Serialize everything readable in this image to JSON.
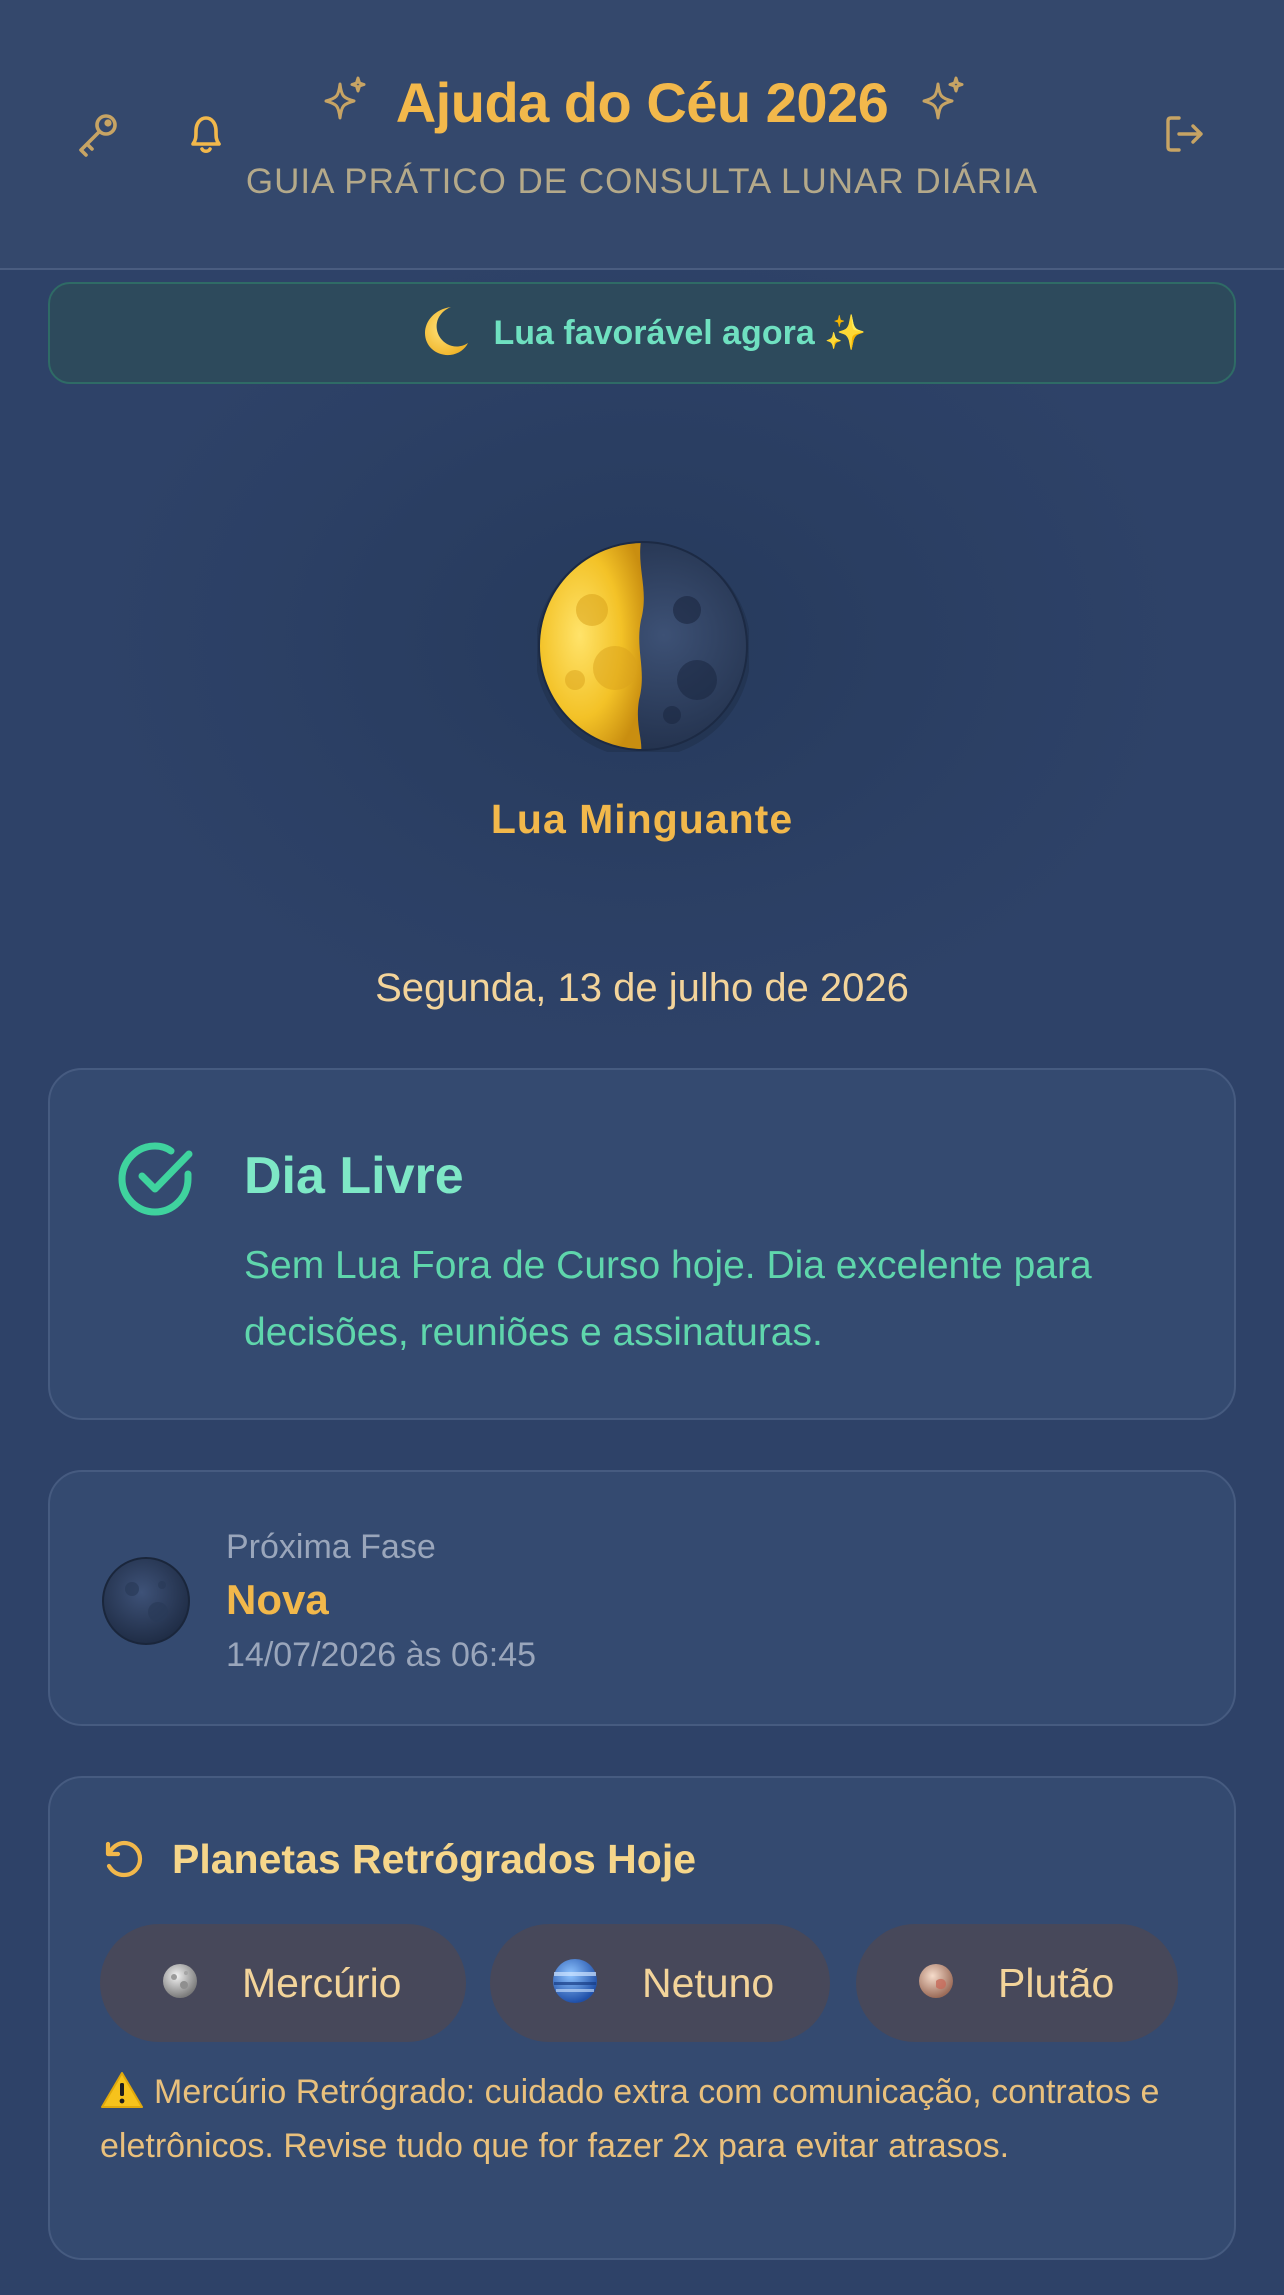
{
  "header": {
    "title": "Ajuda do Céu 2026",
    "subtitle": "GUIA PRÁTICO DE CONSULTA LUNAR DIÁRIA",
    "left_icons": [
      "key-icon",
      "bell-icon"
    ],
    "right_icons": [
      "logout-icon"
    ],
    "decor_icons": [
      "sparkle-icon",
      "sparkle-icon"
    ]
  },
  "banner": {
    "icon": "crescent-moon-icon",
    "text": "Lua favorável agora ✨"
  },
  "moon": {
    "phase_name": "Lua Minguante",
    "date": "Segunda, 13 de julho de 2026"
  },
  "dia_livre": {
    "title": "Dia Livre",
    "text": "Sem Lua Fora de Curso hoje. Dia excelente para decisões, reuniões e assinaturas."
  },
  "next_phase": {
    "label": "Próxima Fase",
    "phase": "Nova",
    "datetime": "14/07/2026 às 06:45"
  },
  "retrograde": {
    "title": "Planetas Retrógrados Hoje",
    "planets": [
      {
        "name": "Mercúrio",
        "icon": "mercury-icon"
      },
      {
        "name": "Netuno",
        "icon": "neptune-icon"
      },
      {
        "name": "Plutão",
        "icon": "pluto-icon"
      }
    ],
    "warning": "Mercúrio Retrógrado: cuidado extra com comunicação, contratos e eletrônicos. Revise tudo que for fazer 2x para evitar atrasos."
  },
  "colors": {
    "accent_gold": "#f2b84b",
    "accent_green": "#6fe0c0",
    "background": "#2c3f63",
    "card": "#344a70"
  }
}
